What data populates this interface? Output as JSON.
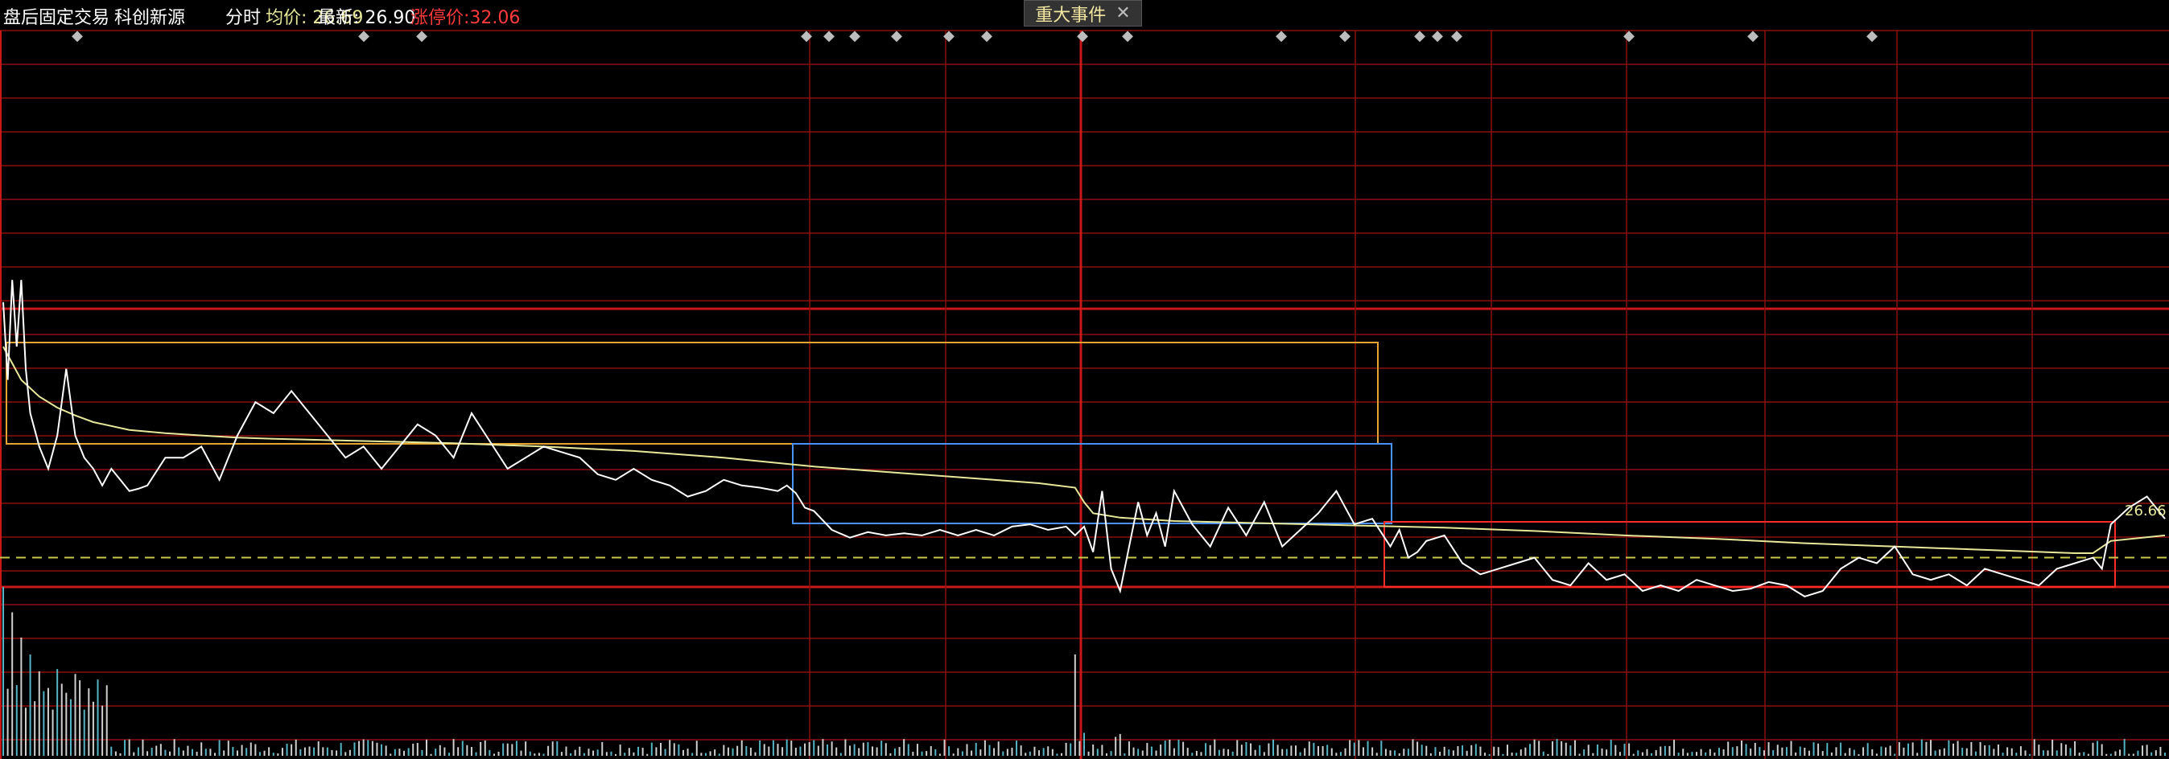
{
  "header": {
    "mode": "盘后固定交易",
    "stock": "科创新源",
    "view": "分时",
    "avg_label": "均价: 26.69",
    "last_label": "最新: 26.90",
    "limit_label": "涨停价:32.06"
  },
  "event_tab": {
    "label": "重大事件",
    "close_glyph": "✕"
  },
  "price_marker": "26.66",
  "colors": {
    "background": "#000000",
    "grid": "#8a0f0f",
    "price_line": "#ffffff",
    "avg_line": "#e8e89a",
    "ref_dash": "#c8c84a",
    "box_orange": "#e8a430",
    "box_blue": "#4a90ff",
    "box_red": "#ff2a2a",
    "volume_cyan": "#56b4c4"
  },
  "event_markers": {
    "glyph": "◆",
    "count": 27
  },
  "chart_data": [
    {
      "type": "line",
      "title": "",
      "xlabel": "",
      "ylabel": "",
      "ylim": [
        26.0,
        29.8
      ],
      "x_range": [
        0,
        240
      ],
      "series": [
        {
          "role": "price",
          "x": [
            0,
            0.5,
            1,
            1.5,
            2,
            2.5,
            3,
            4,
            5,
            6,
            7,
            8,
            9,
            10,
            11,
            12,
            13,
            14,
            15,
            16,
            18,
            20,
            22,
            24,
            26,
            28,
            30,
            32,
            34,
            36,
            38,
            40,
            42,
            44,
            46,
            48,
            50,
            52,
            54,
            56,
            58,
            60,
            62,
            64,
            66,
            68,
            70,
            72,
            74,
            76,
            78,
            80,
            82,
            84,
            86,
            87,
            88,
            89,
            90,
            92,
            94,
            96,
            98,
            100,
            102,
            104,
            106,
            108,
            110,
            112,
            114,
            116,
            118,
            119,
            120,
            121,
            122,
            123,
            124,
            125,
            126,
            127,
            128,
            129,
            130,
            132,
            134,
            136,
            138,
            140,
            142,
            144,
            146,
            148,
            150,
            152,
            154,
            155,
            156,
            157,
            158,
            160,
            162,
            164,
            166,
            168,
            170,
            172,
            174,
            176,
            178,
            180,
            182,
            184,
            186,
            188,
            190,
            192,
            194,
            196,
            198,
            200,
            202,
            204,
            206,
            208,
            210,
            212,
            214,
            216,
            218,
            220,
            222,
            224,
            226,
            228,
            230,
            232,
            233,
            234,
            236,
            238,
            240
          ],
          "y": [
            28.6,
            27.9,
            28.8,
            28.2,
            28.8,
            28.0,
            27.6,
            27.3,
            27.1,
            27.4,
            28.0,
            27.4,
            27.2,
            27.1,
            26.95,
            27.1,
            27.0,
            26.9,
            26.92,
            26.95,
            27.2,
            27.2,
            27.3,
            27.0,
            27.4,
            27.7,
            27.6,
            27.8,
            27.6,
            27.4,
            27.2,
            27.3,
            27.1,
            27.3,
            27.5,
            27.4,
            27.2,
            27.6,
            27.35,
            27.1,
            27.2,
            27.3,
            27.25,
            27.2,
            27.05,
            27.0,
            27.1,
            27.0,
            26.95,
            26.85,
            26.9,
            27.0,
            26.95,
            26.93,
            26.9,
            26.95,
            26.88,
            26.75,
            26.72,
            26.55,
            26.48,
            26.53,
            26.5,
            26.52,
            26.5,
            26.55,
            26.5,
            26.55,
            26.5,
            26.58,
            26.6,
            26.55,
            26.58,
            26.5,
            26.58,
            26.35,
            26.9,
            26.2,
            26.0,
            26.4,
            26.8,
            26.5,
            26.7,
            26.4,
            26.9,
            26.6,
            26.4,
            26.75,
            26.5,
            26.8,
            26.4,
            26.55,
            26.7,
            26.9,
            26.6,
            26.65,
            26.4,
            26.55,
            26.3,
            26.35,
            26.45,
            26.5,
            26.25,
            26.15,
            26.2,
            26.25,
            26.3,
            26.1,
            26.05,
            26.25,
            26.1,
            26.15,
            26.0,
            26.05,
            26.0,
            26.1,
            26.05,
            26.0,
            26.02,
            26.08,
            26.05,
            25.95,
            26.0,
            26.2,
            26.3,
            26.25,
            26.4,
            26.15,
            26.1,
            26.15,
            26.05,
            26.2,
            26.15,
            26.1,
            26.05,
            26.2,
            26.25,
            26.3,
            26.2,
            26.6,
            26.75,
            26.85,
            26.65
          ]
        },
        {
          "role": "average",
          "x": [
            0,
            2,
            4,
            6,
            8,
            10,
            14,
            18,
            22,
            26,
            30,
            40,
            50,
            60,
            70,
            80,
            90,
            100,
            110,
            115,
            119,
            120,
            121,
            124,
            130,
            140,
            150,
            160,
            170,
            180,
            190,
            200,
            210,
            220,
            230,
            232,
            234,
            240
          ],
          "y": [
            28.2,
            27.9,
            27.75,
            27.65,
            27.58,
            27.52,
            27.45,
            27.42,
            27.4,
            27.38,
            27.37,
            27.35,
            27.33,
            27.3,
            27.26,
            27.2,
            27.12,
            27.06,
            27.0,
            26.97,
            26.93,
            26.8,
            26.7,
            26.66,
            26.63,
            26.61,
            26.59,
            26.57,
            26.54,
            26.5,
            26.47,
            26.43,
            26.4,
            26.37,
            26.34,
            26.34,
            26.45,
            26.5
          ]
        }
      ],
      "reference_price": 26.3,
      "annotations": [
        "26.66"
      ]
    },
    {
      "type": "bar",
      "title": "",
      "ylim": [
        0,
        100
      ],
      "x_range": [
        0,
        240
      ],
      "peak_volumes": {
        "x": [
          0,
          1,
          2,
          3,
          4,
          119
        ],
        "values": [
          100,
          85,
          70,
          60,
          50,
          60
        ]
      }
    }
  ]
}
